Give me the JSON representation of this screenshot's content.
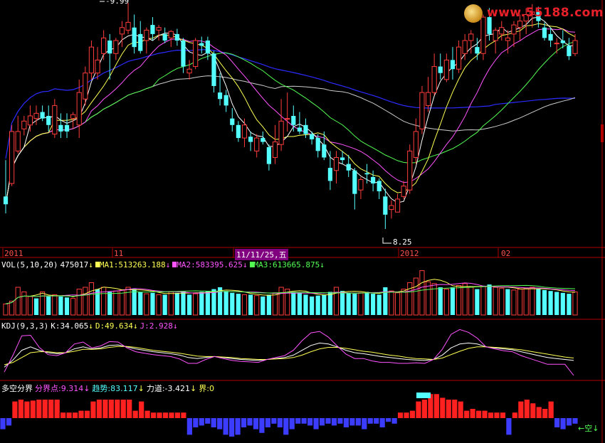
{
  "watermark": "www.55188.com",
  "price_panel": {
    "high_label": "9.99",
    "low_label": "8.25"
  },
  "date_axis": {
    "labels": [
      "2011",
      "11",
      "11/11/25,五",
      "2012",
      "02"
    ],
    "selected_index": 2
  },
  "vol_header": {
    "name": "VOL(5,10,20)",
    "value": "475017",
    "ma1": "MA1:513263.188",
    "ma2": "MA2:583395.625",
    "ma3": "MA3:613665.875"
  },
  "kdj_header": {
    "name": "KDJ(9,3,3)",
    "k": "K:34.065",
    "d": "D:49.634",
    "j": "J:2.928"
  },
  "dkfj_header": {
    "name": "多空分界",
    "fjd": "分界点:9.314",
    "qs": "趋势:83.117",
    "ld": "力道:-3.421",
    "jie": "界:0"
  },
  "dkfj_signal": "空",
  "arrow_glyph": "↓",
  "colors": {
    "up": "#ff3c3c",
    "down": "#54ffff",
    "ma5": "#ffffff",
    "ma10": "#ffff54",
    "ma20": "#ff54ff",
    "ma30": "#54ff54",
    "ma60": "#cccccc",
    "ma120": "#2b2bff",
    "axis": "#b00000",
    "date_text": "#ff5050",
    "selected_bg": "#800080"
  },
  "chart_data": [
    {
      "type": "candlestick",
      "title": "",
      "x": [
        "2011",
        "11",
        "11/11/25,五",
        "2012",
        "02"
      ],
      "ylim": [
        8.25,
        9.99
      ],
      "annotations": [
        {
          "label": "9.99",
          "value": 9.99
        },
        {
          "label": "8.25",
          "value": 8.25
        }
      ],
      "candles": [
        [
          8.5,
          8.78,
          8.37,
          8.44
        ],
        [
          8.6,
          9.05,
          8.58,
          9.0
        ],
        [
          8.85,
          9.12,
          8.83,
          9.0
        ],
        [
          9.02,
          9.12,
          8.97,
          9.08
        ],
        [
          9.05,
          9.2,
          9.0,
          9.12
        ],
        [
          9.1,
          9.2,
          9.05,
          9.14
        ],
        [
          9.15,
          9.2,
          9.08,
          9.1
        ],
        [
          9.12,
          9.2,
          9.0,
          9.05
        ],
        [
          8.98,
          9.25,
          8.95,
          9.2
        ],
        [
          9.05,
          9.14,
          8.95,
          9.0
        ],
        [
          9.05,
          9.14,
          8.95,
          9.0
        ],
        [
          9.1,
          9.15,
          9.02,
          9.13
        ],
        [
          9.05,
          9.4,
          8.95,
          9.3
        ],
        [
          9.25,
          9.5,
          9.2,
          9.45
        ],
        [
          9.45,
          9.7,
          9.4,
          9.65
        ],
        [
          9.45,
          9.65,
          9.4,
          9.55
        ],
        [
          9.6,
          9.78,
          9.55,
          9.72
        ],
        [
          9.7,
          9.75,
          9.4,
          9.6
        ],
        [
          9.6,
          9.72,
          9.55,
          9.7
        ],
        [
          9.75,
          9.85,
          9.65,
          9.8
        ],
        [
          9.78,
          9.99,
          9.75,
          9.84
        ],
        [
          9.8,
          9.9,
          9.6,
          9.65
        ],
        [
          9.75,
          9.85,
          9.6,
          9.62
        ],
        [
          9.7,
          9.8,
          9.6,
          9.78
        ],
        [
          9.82,
          9.88,
          9.7,
          9.75
        ],
        [
          9.78,
          9.82,
          9.7,
          9.8
        ],
        [
          9.75,
          9.8,
          9.68,
          9.7
        ],
        [
          9.72,
          9.78,
          9.65,
          9.77
        ],
        [
          9.75,
          9.79,
          9.66,
          9.7
        ],
        [
          9.7,
          9.72,
          9.45,
          9.5
        ],
        [
          9.45,
          9.55,
          9.4,
          9.48
        ],
        [
          9.5,
          9.72,
          9.48,
          9.7
        ],
        [
          9.68,
          9.73,
          9.6,
          9.66
        ],
        [
          9.7,
          9.73,
          9.55,
          9.6
        ],
        [
          9.6,
          9.62,
          9.3,
          9.35
        ],
        [
          9.3,
          9.45,
          9.2,
          9.25
        ],
        [
          9.28,
          9.32,
          9.15,
          9.2
        ],
        [
          9.1,
          9.18,
          9.0,
          9.05
        ],
        [
          9.05,
          9.08,
          8.92,
          8.95
        ],
        [
          8.95,
          9.1,
          8.88,
          9.05
        ],
        [
          8.96,
          9.0,
          8.85,
          8.92
        ],
        [
          8.85,
          8.98,
          8.8,
          8.95
        ],
        [
          8.95,
          9.0,
          8.9,
          8.92
        ],
        [
          8.88,
          8.9,
          8.7,
          8.75
        ],
        [
          8.8,
          9.05,
          8.75,
          8.92
        ],
        [
          8.9,
          9.25,
          8.85,
          9.08
        ],
        [
          9.1,
          9.3,
          9.0,
          9.1
        ],
        [
          9.12,
          9.2,
          9.0,
          9.05
        ],
        [
          9.03,
          9.15,
          8.98,
          9.0
        ],
        [
          9.05,
          9.1,
          8.95,
          8.98
        ],
        [
          8.98,
          9.0,
          8.9,
          8.94
        ],
        [
          8.95,
          8.98,
          8.8,
          8.85
        ],
        [
          8.9,
          9.0,
          8.78,
          8.8
        ],
        [
          8.72,
          8.85,
          8.55,
          8.62
        ],
        [
          8.7,
          8.85,
          8.6,
          8.8
        ],
        [
          8.8,
          8.85,
          8.75,
          8.78
        ],
        [
          8.75,
          8.82,
          8.65,
          8.7
        ],
        [
          8.7,
          8.72,
          8.4,
          8.52
        ],
        [
          8.55,
          8.65,
          8.48,
          8.63
        ],
        [
          8.68,
          8.75,
          8.6,
          8.67
        ],
        [
          8.65,
          8.7,
          8.54,
          8.6
        ],
        [
          8.62,
          8.64,
          8.48,
          8.54
        ],
        [
          8.5,
          8.56,
          8.25,
          8.36
        ],
        [
          8.4,
          8.47,
          8.33,
          8.43
        ],
        [
          8.38,
          8.52,
          8.38,
          8.48
        ],
        [
          8.5,
          8.62,
          8.48,
          8.58
        ],
        [
          8.55,
          8.9,
          8.52,
          8.85
        ],
        [
          8.8,
          9.1,
          8.75,
          9.0
        ],
        [
          9.02,
          9.35,
          8.98,
          9.3
        ],
        [
          9.2,
          9.42,
          9.15,
          9.3
        ],
        [
          9.3,
          9.6,
          9.28,
          9.5
        ],
        [
          9.5,
          9.6,
          9.4,
          9.45
        ],
        [
          9.4,
          9.6,
          9.38,
          9.55
        ],
        [
          9.55,
          9.65,
          9.4,
          9.48
        ],
        [
          9.48,
          9.7,
          9.45,
          9.65
        ],
        [
          9.6,
          9.75,
          9.55,
          9.7
        ],
        [
          9.7,
          9.78,
          9.6,
          9.75
        ],
        [
          9.65,
          9.72,
          9.55,
          9.6
        ],
        [
          9.6,
          9.9,
          9.55,
          9.88
        ],
        [
          9.88,
          9.95,
          9.7,
          9.75
        ],
        [
          9.7,
          9.8,
          9.6,
          9.78
        ],
        [
          9.75,
          9.85,
          9.7,
          9.8
        ],
        [
          9.7,
          9.78,
          9.6,
          9.72
        ],
        [
          9.75,
          9.85,
          9.65,
          9.82
        ],
        [
          9.8,
          9.9,
          9.7,
          9.85
        ],
        [
          9.85,
          9.95,
          9.75,
          9.9
        ],
        [
          9.9,
          9.98,
          9.8,
          9.92
        ],
        [
          9.92,
          9.96,
          9.8,
          9.85
        ],
        [
          9.8,
          9.84,
          9.7,
          9.72
        ],
        [
          9.75,
          9.8,
          9.65,
          9.7
        ],
        [
          9.68,
          9.72,
          9.6,
          9.68
        ],
        [
          9.7,
          9.78,
          9.64,
          9.68
        ],
        [
          9.66,
          9.72,
          9.55,
          9.58
        ],
        [
          9.6,
          9.75,
          9.58,
          9.7
        ]
      ]
    },
    {
      "type": "bar",
      "title": "VOL(5,10,20)",
      "values": [
        0.12,
        0.15,
        0.3,
        0.25,
        0.2,
        0.18,
        0.25,
        0.2,
        0.22,
        0.2,
        0.19,
        0.18,
        0.28,
        0.3,
        0.35,
        0.28,
        0.3,
        0.25,
        0.26,
        0.27,
        0.3,
        0.28,
        0.25,
        0.23,
        0.24,
        0.22,
        0.22,
        0.25,
        0.24,
        0.26,
        0.22,
        0.23,
        0.25,
        0.26,
        0.28,
        0.3,
        0.26,
        0.24,
        0.23,
        0.22,
        0.22,
        0.21,
        0.2,
        0.22,
        0.24,
        0.3,
        0.28,
        0.25,
        0.24,
        0.22,
        0.2,
        0.21,
        0.22,
        0.25,
        0.3,
        0.26,
        0.24,
        0.23,
        0.24,
        0.25,
        0.23,
        0.22,
        0.3,
        0.26,
        0.24,
        0.28,
        0.35,
        0.4,
        0.48,
        0.36,
        0.34,
        0.3,
        0.28,
        0.3,
        0.32,
        0.34,
        0.3,
        0.28,
        0.31,
        0.33,
        0.3,
        0.29,
        0.28,
        0.27,
        0.28,
        0.29,
        0.3,
        0.28,
        0.27,
        0.26,
        0.25,
        0.24,
        0.23,
        0.25
      ],
      "up": [
        true,
        true,
        true,
        true,
        true,
        false,
        true,
        false,
        true,
        false,
        false,
        true,
        true,
        true,
        true,
        false,
        true,
        false,
        true,
        true,
        true,
        false,
        false,
        true,
        false,
        true,
        false,
        true,
        false,
        false,
        false,
        true,
        false,
        false,
        false,
        false,
        false,
        false,
        false,
        true,
        false,
        true,
        false,
        false,
        true,
        true,
        true,
        false,
        false,
        false,
        false,
        false,
        false,
        false,
        true,
        false,
        false,
        false,
        true,
        false,
        false,
        false,
        false,
        true,
        true,
        true,
        true,
        true,
        true,
        true,
        true,
        false,
        true,
        false,
        true,
        true,
        true,
        false,
        true,
        false,
        true,
        true,
        false,
        true,
        true,
        true,
        true,
        false,
        false,
        false,
        false,
        false,
        false,
        true
      ]
    },
    {
      "type": "line",
      "title": "KDJ(9,3,3)",
      "series": [
        {
          "name": "K",
          "values": [
            20,
            35,
            55,
            62,
            55,
            50,
            48,
            50,
            58,
            62,
            58,
            60,
            65,
            66,
            62,
            58,
            55,
            52,
            50,
            48,
            45,
            40,
            38,
            40,
            42,
            40,
            38,
            36,
            35,
            34,
            36,
            38,
            40,
            45,
            55,
            65,
            70,
            68,
            62,
            55,
            50,
            48,
            45,
            42,
            40,
            38,
            36,
            35,
            34,
            36,
            45,
            60,
            68,
            70,
            68,
            62,
            60,
            58,
            56,
            52,
            48,
            44,
            40,
            38,
            36,
            34
          ]
        },
        {
          "name": "D",
          "values": [
            25,
            30,
            40,
            50,
            52,
            52,
            50,
            50,
            53,
            57,
            57,
            58,
            61,
            63,
            63,
            61,
            58,
            55,
            53,
            51,
            49,
            46,
            43,
            42,
            42,
            41,
            40,
            38,
            37,
            36,
            36,
            37,
            38,
            40,
            45,
            52,
            58,
            61,
            61,
            59,
            56,
            53,
            51,
            48,
            45,
            43,
            40,
            38,
            37,
            36,
            39,
            46,
            53,
            59,
            62,
            62,
            61,
            60,
            58,
            56,
            53,
            50,
            47,
            44,
            41,
            39
          ]
        },
        {
          "name": "J",
          "values": [
            10,
            45,
            85,
            86,
            61,
            46,
            44,
            50,
            68,
            72,
            60,
            64,
            73,
            72,
            60,
            52,
            49,
            46,
            44,
            42,
            37,
            28,
            28,
            36,
            42,
            38,
            34,
            32,
            31,
            30,
            36,
            40,
            44,
            55,
            75,
            91,
            94,
            82,
            64,
            47,
            38,
            38,
            33,
            30,
            30,
            28,
            28,
            29,
            28,
            36,
            57,
            88,
            98,
            92,
            80,
            62,
            58,
            54,
            52,
            44,
            38,
            32,
            26,
            26,
            26,
            3
          ]
        }
      ]
    },
    {
      "type": "bar",
      "title": "多空分界",
      "values": [
        -0.6,
        -0.4,
        0.9,
        1.0,
        0.9,
        0.95,
        1.0,
        1.0,
        1.0,
        1.0,
        0.3,
        0.3,
        0.3,
        0.4,
        0.4,
        0.9,
        1.0,
        1.0,
        1.0,
        1.0,
        1.0,
        1.0,
        0.4,
        0.9,
        0.4,
        0.3,
        0.3,
        0.3,
        0.3,
        0.3,
        0.3,
        -0.9,
        -0.5,
        -0.4,
        -0.3,
        -0.5,
        -0.6,
        -0.9,
        -1.0,
        -0.9,
        -0.5,
        -0.4,
        -0.6,
        -0.8,
        -0.5,
        -0.3,
        -0.5,
        -0.9,
        -0.6,
        -0.3,
        -0.3,
        -0.4,
        -0.6,
        -0.4,
        -0.3,
        -0.4,
        -0.3,
        -0.5,
        -0.4,
        -0.4,
        -0.6,
        -0.3,
        -0.3,
        -0.5,
        -0.2,
        -0.3,
        0.3,
        0.3,
        0.4,
        0.9,
        1.0,
        1.3,
        1.3,
        1.1,
        1.0,
        1.0,
        0.9,
        0.4,
        0.5,
        0.4,
        0.4,
        0.3,
        0.3,
        0.3,
        -0.9,
        0.3,
        0.9,
        1.0,
        0.8,
        0.6,
        0.5,
        0.9,
        -0.5,
        -0.6,
        -0.4,
        -0.3
      ]
    }
  ]
}
